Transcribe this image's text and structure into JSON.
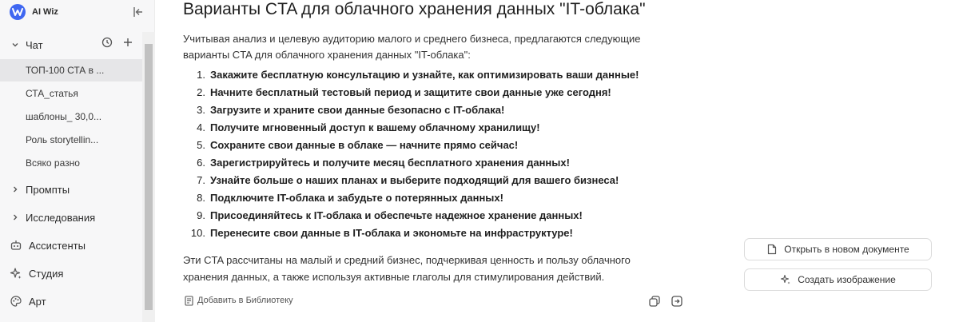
{
  "app": {
    "name": "AI Wiz"
  },
  "sidebar": {
    "sections": {
      "chat": "Чат",
      "prompts": "Промпты",
      "research": "Исследования",
      "assistants": "Ассистенты",
      "studio": "Студия",
      "art": "Арт"
    },
    "chats": [
      "ТОП-100 СТА в ...",
      "СТА_статья",
      "шаблоны_ 30,0...",
      "Роль storytellin...",
      "Всяко разно"
    ]
  },
  "message": {
    "title": "Варианты CTA для облачного хранения данных \"IT-облака\"",
    "intro": "Учитывая анализ и целевую аудиторию малого и среднего бизнеса, предлагаются следующие варианты CTA для облачного хранения данных \"IT-облака\":",
    "items": [
      "Закажите бесплатную консультацию и узнайте, как оптимизировать ваши данные!",
      "Начните бесплатный тестовый период и защитите свои данные уже сегодня!",
      "Загрузите и храните свои данные безопасно с IT-облака!",
      "Получите мгновенный доступ к вашему облачному хранилищу!",
      "Сохраните свои данные в облаке — начните прямо сейчас!",
      "Зарегистрируйтесь и получите месяц бесплатного хранения данных!",
      "Узнайте больше о наших планах и выберите подходящий для вашего бизнеса!",
      "Подключите IT-облака и забудьте о потерянных данных!",
      "Присоединяйтесь к IT-облака и обеспечьте надежное хранение данных!",
      "Перенесите свои данные в IT-облака и экономьте на инфраструктуре!"
    ],
    "numbers": [
      "1.",
      "2.",
      "3.",
      "4.",
      "5.",
      "6.",
      "7.",
      "8.",
      "9.",
      "10."
    ],
    "outro": "Эти CTA рассчитаны на малый и средний бизнес, подчеркивая ценность и пользу облачного хранения данных, а также используя активные глаголы для стимулирования действий.",
    "add_to_library": "Добавить в Библиотеку"
  },
  "actions": {
    "open_doc": "Открыть в новом документе",
    "create_image": "Создать изображение"
  },
  "colors": {
    "brand": "#3f67f1",
    "active_item": "#e6e6e8"
  }
}
